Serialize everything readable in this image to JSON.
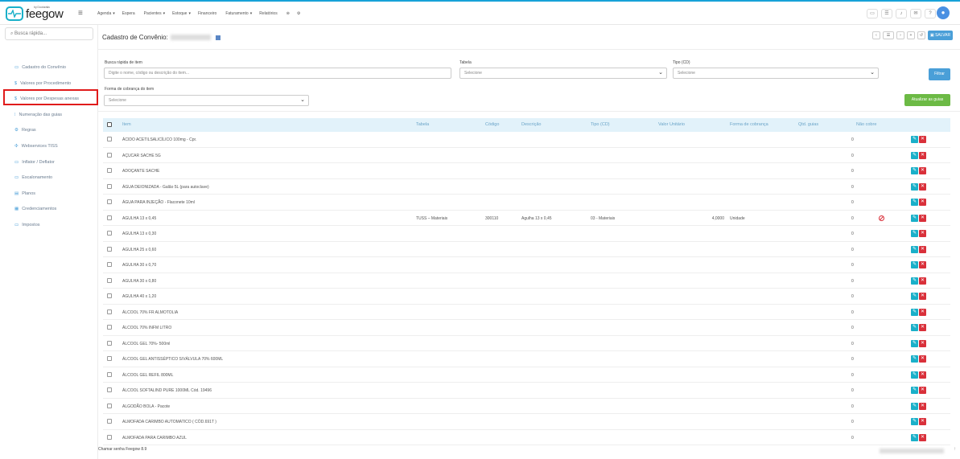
{
  "brand": {
    "tagline": "by Doctoralia",
    "name": "feegow",
    "accent": "#1ab0c9"
  },
  "nav": [
    {
      "label": "Agenda",
      "caret": "▾"
    },
    {
      "label": "Espera",
      "caret": ""
    },
    {
      "label": "Pacientes",
      "caret": "▾"
    },
    {
      "label": "Estoque",
      "caret": "▾"
    },
    {
      "label": "Financeiro",
      "caret": ""
    },
    {
      "label": "Faturamento",
      "caret": "▾"
    },
    {
      "label": "Relatórios",
      "caret": ""
    }
  ],
  "search": {
    "placeholder": "Busca rápida..."
  },
  "sidebar": {
    "items": [
      {
        "label": "Cadastro do Convênio",
        "icon": "card-icon"
      },
      {
        "label": "Valores por Procedimento",
        "icon": "dollar-icon"
      },
      {
        "label": "Valores por Despesas anexas",
        "icon": "dollar-icon"
      },
      {
        "label": "Numeração das guias",
        "icon": "numbers-icon"
      },
      {
        "label": "Regras",
        "icon": "rules-icon"
      },
      {
        "label": "Webservices TISS",
        "icon": "webservice-icon"
      },
      {
        "label": "Inflator / Deflator",
        "icon": "card-icon"
      },
      {
        "label": "Escalonamento",
        "icon": "card-icon"
      },
      {
        "label": "Planos",
        "icon": "list-icon"
      },
      {
        "label": "Credenciamentos",
        "icon": "doc-icon"
      },
      {
        "label": "Impostos",
        "icon": "card-icon"
      }
    ]
  },
  "page": {
    "title": "Cadastro de Convênio:",
    "save_label": "SALVAR"
  },
  "filters": {
    "busca_label": "Busca rápida de item",
    "busca_placeholder": "Digite o nome, código ou descrição do item...",
    "tabela_label": "Tabela",
    "tabela_value": "Selecione",
    "tipo_label": "Tipo (CD)",
    "tipo_value": "Selecione",
    "forma_label": "Forma de cobrança do item",
    "forma_value": "Selecione",
    "filtrar_label": "Filtrar",
    "atualizar_label": "Atualizar as guias"
  },
  "table": {
    "headers": {
      "item": "Item",
      "tabela": "Tabela",
      "codigo": "Código",
      "descricao": "Descrição",
      "tipo": "Tipo (CD)",
      "valor": "Valor Unitário",
      "forma": "Forma de cobrança",
      "qtd": "Qtd. guias",
      "naocobre": "Não cobre"
    },
    "rows": [
      {
        "item": "ÁCIDO ACETILSALICÍLICO 100mg - Cpr.",
        "tabela": "",
        "codigo": "",
        "descricao": "",
        "tipo": "",
        "valor": "",
        "forma": "",
        "qtd": "0"
      },
      {
        "item": "AÇUCAR SACHE 5G",
        "tabela": "",
        "codigo": "",
        "descricao": "",
        "tipo": "",
        "valor": "",
        "forma": "",
        "qtd": "0"
      },
      {
        "item": "ADOÇANTE SACHE",
        "tabela": "",
        "codigo": "",
        "descricao": "",
        "tipo": "",
        "valor": "",
        "forma": "",
        "qtd": "0"
      },
      {
        "item": "ÁGUA DEIONIZADA - Galão 5L (para autoclave)",
        "tabela": "",
        "codigo": "",
        "descricao": "",
        "tipo": "",
        "valor": "",
        "forma": "",
        "qtd": "0"
      },
      {
        "item": "ÁGUA PARA INJEÇÃO - Flaconete 10ml",
        "tabela": "",
        "codigo": "",
        "descricao": "",
        "tipo": "",
        "valor": "",
        "forma": "",
        "qtd": "0"
      },
      {
        "item": "AGULHA 13 x 0,45",
        "tabela": "TUSS – Materiais",
        "codigo": "300110",
        "descricao": "Agulha 13 x 0,45",
        "tipo": "03 - Materiais",
        "valor": "4,0000",
        "forma": "Unidade",
        "qtd": "0",
        "naocobre": true
      },
      {
        "item": "AGULHA 13 x 0,30",
        "tabela": "",
        "codigo": "",
        "descricao": "",
        "tipo": "",
        "valor": "",
        "forma": "",
        "qtd": "0"
      },
      {
        "item": "AGULHA 25 x 0,60",
        "tabela": "",
        "codigo": "",
        "descricao": "",
        "tipo": "",
        "valor": "",
        "forma": "",
        "qtd": "0"
      },
      {
        "item": "AGULHA 30 x 0,70",
        "tabela": "",
        "codigo": "",
        "descricao": "",
        "tipo": "",
        "valor": "",
        "forma": "",
        "qtd": "0"
      },
      {
        "item": "AGULHA 30 x 0,80",
        "tabela": "",
        "codigo": "",
        "descricao": "",
        "tipo": "",
        "valor": "",
        "forma": "",
        "qtd": "0"
      },
      {
        "item": "AGULHA 40 x 1,20",
        "tabela": "",
        "codigo": "",
        "descricao": "",
        "tipo": "",
        "valor": "",
        "forma": "",
        "qtd": "0"
      },
      {
        "item": "ÁLCOOL 70% FR ALMOTOLIA",
        "tabela": "",
        "codigo": "",
        "descricao": "",
        "tipo": "",
        "valor": "",
        "forma": "",
        "qtd": "0"
      },
      {
        "item": "ÁLCOOL 70% INFM LITRO",
        "tabela": "",
        "codigo": "",
        "descricao": "",
        "tipo": "",
        "valor": "",
        "forma": "",
        "qtd": "0"
      },
      {
        "item": "ÁLCOOL GEL 70%- 500ml",
        "tabela": "",
        "codigo": "",
        "descricao": "",
        "tipo": "",
        "valor": "",
        "forma": "",
        "qtd": "0"
      },
      {
        "item": "ÁLCOOL GEL ANTISSÉPTICO S/VÁLVULA 70% 600ML",
        "tabela": "",
        "codigo": "",
        "descricao": "",
        "tipo": "",
        "valor": "",
        "forma": "",
        "qtd": "0"
      },
      {
        "item": "ÁLCOOL GEL REFIL 800ML",
        "tabela": "",
        "codigo": "",
        "descricao": "",
        "tipo": "",
        "valor": "",
        "forma": "",
        "qtd": "0"
      },
      {
        "item": "ÁLCOOL SOFTALIND PURE 1000ML Cód. 19496",
        "tabela": "",
        "codigo": "",
        "descricao": "",
        "tipo": "",
        "valor": "",
        "forma": "",
        "qtd": "0"
      },
      {
        "item": "ALGODÃO BOLA - Pacote",
        "tabela": "",
        "codigo": "",
        "descricao": "",
        "tipo": "",
        "valor": "",
        "forma": "",
        "qtd": "0"
      },
      {
        "item": "ALMOFADA CARIMBO AUTOMATICO ( CÓD.691T )",
        "tabela": "",
        "codigo": "",
        "descricao": "",
        "tipo": "",
        "valor": "",
        "forma": "",
        "qtd": "0"
      },
      {
        "item": "ALMOFADA PARA CARIMBO AZUL",
        "tabela": "",
        "codigo": "",
        "descricao": "",
        "tipo": "",
        "valor": "",
        "forma": "",
        "qtd": "0"
      }
    ]
  },
  "status": {
    "chat": "Chamar senha",
    "version": "Feegow 8.9"
  }
}
